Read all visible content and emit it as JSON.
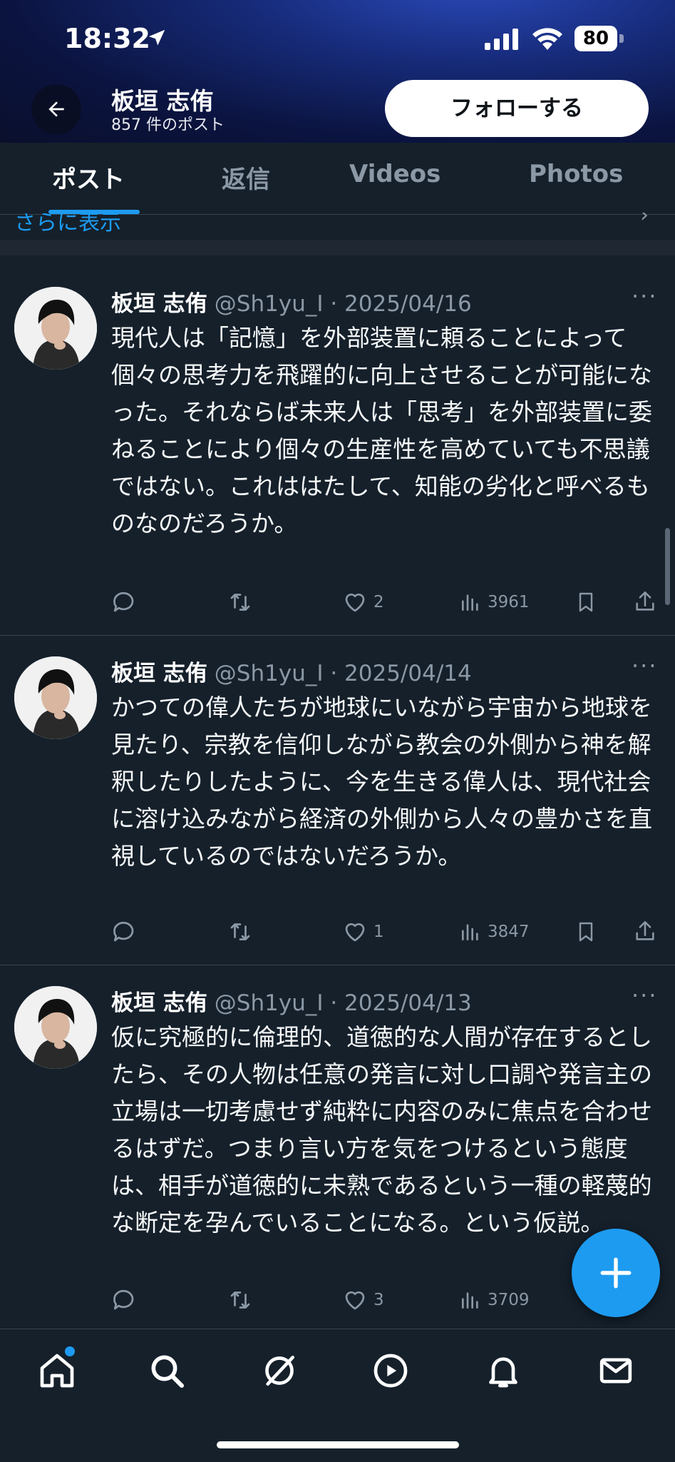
{
  "status": {
    "time": "18:32",
    "battery": "80"
  },
  "header": {
    "name": "板垣 志侑",
    "post_count": "857 件のポスト",
    "follow_label": "フォローする"
  },
  "tabs": [
    {
      "label": "ポスト",
      "active": true
    },
    {
      "label": "返信",
      "active": false
    },
    {
      "label": "Videos",
      "active": false
    },
    {
      "label": "Photos",
      "active": false
    }
  ],
  "show_more": "さらに表示",
  "tweets": [
    {
      "name": "板垣 志侑",
      "handle": "@Sh1yu_I · 2025/04/16",
      "text": "現代人は「記憶」を外部装置に頼ることによって個々の思考力を飛躍的に向上させることが可能になった。それならば未来人は「思考」を外部装置に委ねることにより個々の生産性を高めていても不思議ではない。これははたして、知能の劣化と呼べるものなのだろうか。",
      "likes": "2",
      "views": "3961"
    },
    {
      "name": "板垣 志侑",
      "handle": "@Sh1yu_I · 2025/04/14",
      "text": "かつての偉人たちが地球にいながら宇宙から地球を見たり、宗教を信仰しながら教会の外側から神を解釈したりしたように、今を生きる偉人は、現代社会に溶け込みながら経済の外側から人々の豊かさを直視しているのではないだろうか。",
      "likes": "1",
      "views": "3847"
    },
    {
      "name": "板垣 志侑",
      "handle": "@Sh1yu_I · 2025/04/13",
      "text": "仮に究極的に倫理的、道徳的な人間が存在するとしたら、その人物は任意の発言に対し口調や発言主の立場は一切考慮せず純粋に内容のみに焦点を合わせるはずだ。つまり言い方を気をつけるという態度は、相手が道徳的に未熟であるという一種の軽蔑的な断定を孕んでいることになる。という仮説。",
      "likes": "3",
      "views": "3709"
    }
  ],
  "colors": {
    "accent": "#1d9bf0",
    "background": "#15202b",
    "muted": "#8b98a5"
  },
  "nav": [
    "home-icon",
    "search-icon",
    "grok-icon",
    "video-icon",
    "notifications-icon",
    "messages-icon"
  ]
}
